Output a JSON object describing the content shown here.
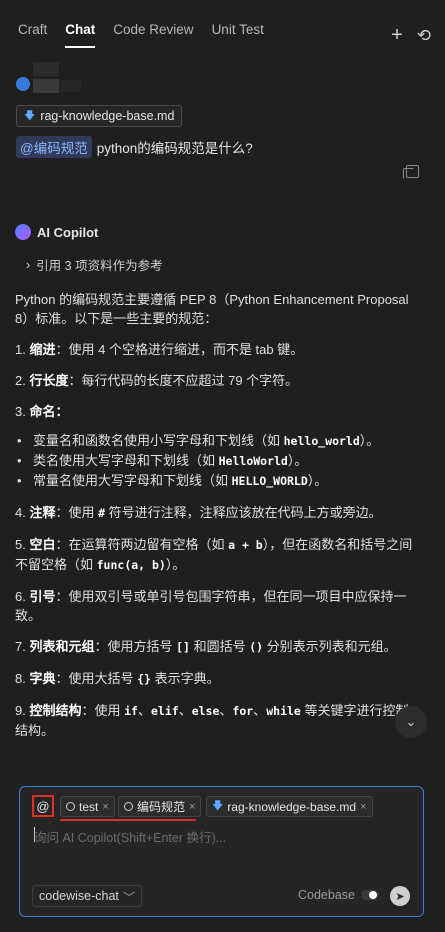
{
  "tabs": [
    {
      "label": "Craft"
    },
    {
      "label": "Chat"
    },
    {
      "label": "Code Review"
    },
    {
      "label": "Unit Test"
    }
  ],
  "top_actions": {
    "add_icon": "+",
    "history_icon": "⟲"
  },
  "user_message": {
    "file": "rag-knowledge-base.md",
    "mention": "@编码规范",
    "text": "python的编码规范是什么?"
  },
  "bot": {
    "name": "AI Copilot",
    "references": "引用 3 项资料作为参考"
  },
  "answer": {
    "intro": "Python 的编码规范主要遵循 PEP 8（Python Enhancement Proposal 8）标准。以下是一些主要的规范：",
    "item1": {
      "num": "1.",
      "title": "缩进",
      "text": "：使用 4 个空格进行缩进，而不是 tab 键。"
    },
    "item2": {
      "num": "2.",
      "title": "行长度",
      "text": "：每行代码的长度不应超过 79 个字符。"
    },
    "item3": {
      "num": "3.",
      "title": "命名",
      "text": "："
    },
    "bullets": [
      {
        "pre": "变量名和函数名使用小写字母和下划线（如 ",
        "code": "hello_world",
        "post": "）。"
      },
      {
        "pre": "类名使用大写字母和下划线（如 ",
        "code": "HelloWorld",
        "post": "）。"
      },
      {
        "pre": "常量名使用大写字母和下划线（如 ",
        "code": "HELLO_WORLD",
        "post": "）。"
      }
    ],
    "item4": {
      "num": "4.",
      "title": "注释",
      "pre": "：使用 ",
      "code": "#",
      "post": " 符号进行注释，注释应该放在代码上方或旁边。"
    },
    "item5": {
      "num": "5.",
      "title": "空白",
      "pre": "：在运算符两边留有空格（如 ",
      "code1": "a + b",
      "mid": "），但在函数名和括号之间不留空格（如 ",
      "code2": "func(a, b)",
      "post": "）。"
    },
    "item6": {
      "num": "6.",
      "title": "引号",
      "text": "：使用双引号或单引号包围字符串，但在同一项目中应保持一致。"
    },
    "item7": {
      "num": "7.",
      "title": "列表和元组",
      "pre": "：使用方括号 ",
      "code1": "[]",
      "mid": " 和圆括号 ",
      "code2": "()",
      "post": " 分别表示列表和元组。"
    },
    "item8": {
      "num": "8.",
      "title": "字典",
      "pre": "：使用大括号 ",
      "code": "{}",
      "post": " 表示字典。"
    },
    "item9": {
      "num": "9.",
      "title": "控制结构",
      "pre": "：使用 ",
      "k1": "if",
      "k2": "elif",
      "k3": "else",
      "k4": "for",
      "k5": "while",
      "sep": "、",
      "post": " 等关键字进行控制结构。"
    }
  },
  "input": {
    "at": "@",
    "chips": [
      {
        "label": "test",
        "icon": "bulb-icon"
      },
      {
        "label": "编码规范",
        "icon": "bulb-icon"
      },
      {
        "label": "rag-knowledge-base.md",
        "icon": "file-icon"
      }
    ],
    "close": "×",
    "placeholder": "询问 AI Copilot(Shift+Enter 换行)...",
    "model": "codewise-chat",
    "codebase_label": "Codebase"
  },
  "colors": {
    "accent": "#3d7fe0",
    "highlight": "#e0302a",
    "background": "#1f1f1f"
  }
}
